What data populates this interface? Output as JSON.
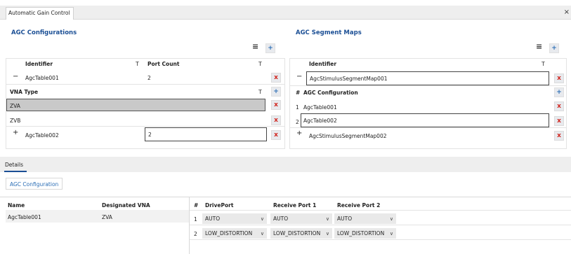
{
  "top_tab": {
    "label": "Automatic Gain Control"
  },
  "agc_configurations": {
    "title": "AGC Configurations",
    "columns": [
      "Identifier",
      "Port Count"
    ],
    "rows": [
      {
        "expander": "−",
        "identifier": "AgcTable001",
        "port_count": "2"
      },
      {
        "expander": "+",
        "identifier": "AgcTable002",
        "port_count": "2"
      }
    ],
    "vna_header": "VNA Type",
    "vna_rows": [
      "ZVA",
      "ZVB"
    ]
  },
  "agc_segment_maps": {
    "title": "AGC Segment Maps",
    "column": "Identifier",
    "rows": [
      {
        "expander": "−",
        "identifier": "AgcStimulusSegmentMap001"
      },
      {
        "expander": "+",
        "identifier": "AgcStimulusSegmentMap002"
      }
    ],
    "sub_header_hash": "#",
    "sub_header": "AGC Configuration",
    "sub_rows": [
      {
        "index": "1",
        "value": "AgcTable001"
      },
      {
        "index": "2",
        "value": "AgcTable002"
      }
    ]
  },
  "details": {
    "tab_label": "Details",
    "sub_tab_label": "AGC Configuration",
    "left_columns": [
      "Name",
      "Designated VNA"
    ],
    "left_rows": [
      {
        "name": "AgcTable001",
        "vna": "ZVA"
      }
    ],
    "right_columns": [
      "#",
      "DrivePort",
      "Receive Port 1",
      "Receive Port 2"
    ],
    "right_rows": [
      {
        "index": "1",
        "drive": "AUTO",
        "rp1": "AUTO",
        "rp2": "AUTO"
      },
      {
        "index": "2",
        "drive": "LOW_DISTORTION",
        "rp1": "LOW_DISTORTION",
        "rp2": "LOW_DISTORTION"
      }
    ]
  },
  "icons": {
    "close": "×",
    "delete": "x",
    "add": "+",
    "menu": "≡",
    "filter": "T",
    "chevron": "∨"
  },
  "colors": {
    "accent": "#1b4f95",
    "delete": "#d0241c",
    "selected_row": "#c9c9c9"
  }
}
